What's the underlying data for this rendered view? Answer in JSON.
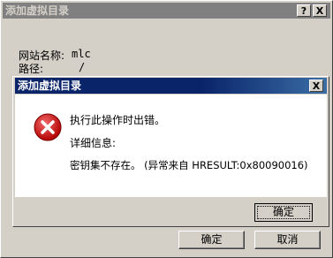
{
  "outer_dialog": {
    "title": "添加虚拟目录",
    "help_button": "?",
    "close_button": "X",
    "site_name_label": "网站名称:",
    "site_name_value": "mlc",
    "path_label": "路径:",
    "path_value": "/",
    "ok_button": "确定",
    "cancel_button": "取消"
  },
  "error_dialog": {
    "title": "添加虚拟目录",
    "close_button": "X",
    "message": "执行此操作时出错。",
    "details_label": "详细信息:",
    "details": "密钥集不存在。 (异常来自 HRESULT:0x80090016)",
    "ok_button": "确定"
  },
  "icons": {
    "error": "error-icon"
  },
  "colors": {
    "active_title": "#0a246a",
    "inactive_title": "#808080",
    "error_red": "#c8102e"
  }
}
